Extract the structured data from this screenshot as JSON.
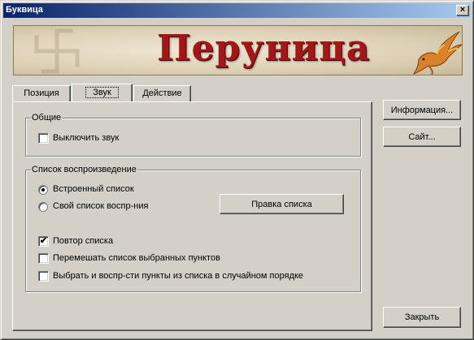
{
  "window": {
    "title": "Буквица",
    "close_glyph": "×"
  },
  "banner": {
    "title": "Перуница"
  },
  "tabs": [
    {
      "label": "Позиция",
      "selected": false
    },
    {
      "label": "Звук",
      "selected": true
    },
    {
      "label": "Действие",
      "selected": false
    }
  ],
  "general_group": {
    "title": "Общие",
    "mute_label": "Выключить звук",
    "mute_checked": false
  },
  "playlist_group": {
    "title": "Список воспроизведение",
    "builtin_label": "Встроенный список",
    "builtin_selected": true,
    "custom_label": "Свой список воспр-ния",
    "custom_selected": false,
    "edit_button_label": "Правка списка",
    "repeat_label": "Повтор списка",
    "repeat_checked": true,
    "shuffle_label": "Перемешать список выбранных пунктов",
    "shuffle_checked": false,
    "random_label": "Выбрать и воспр-сти пункты из списка в случайном порядке",
    "random_checked": false
  },
  "side_buttons": {
    "info_label": "Информация...",
    "site_label": "Сайт...",
    "close_label": "Закрыть"
  },
  "colors": {
    "title_bar_start": "#0a246a",
    "title_bar_end": "#a6caf0",
    "banner_title": "#a4161a",
    "face": "#d4d0c8"
  }
}
